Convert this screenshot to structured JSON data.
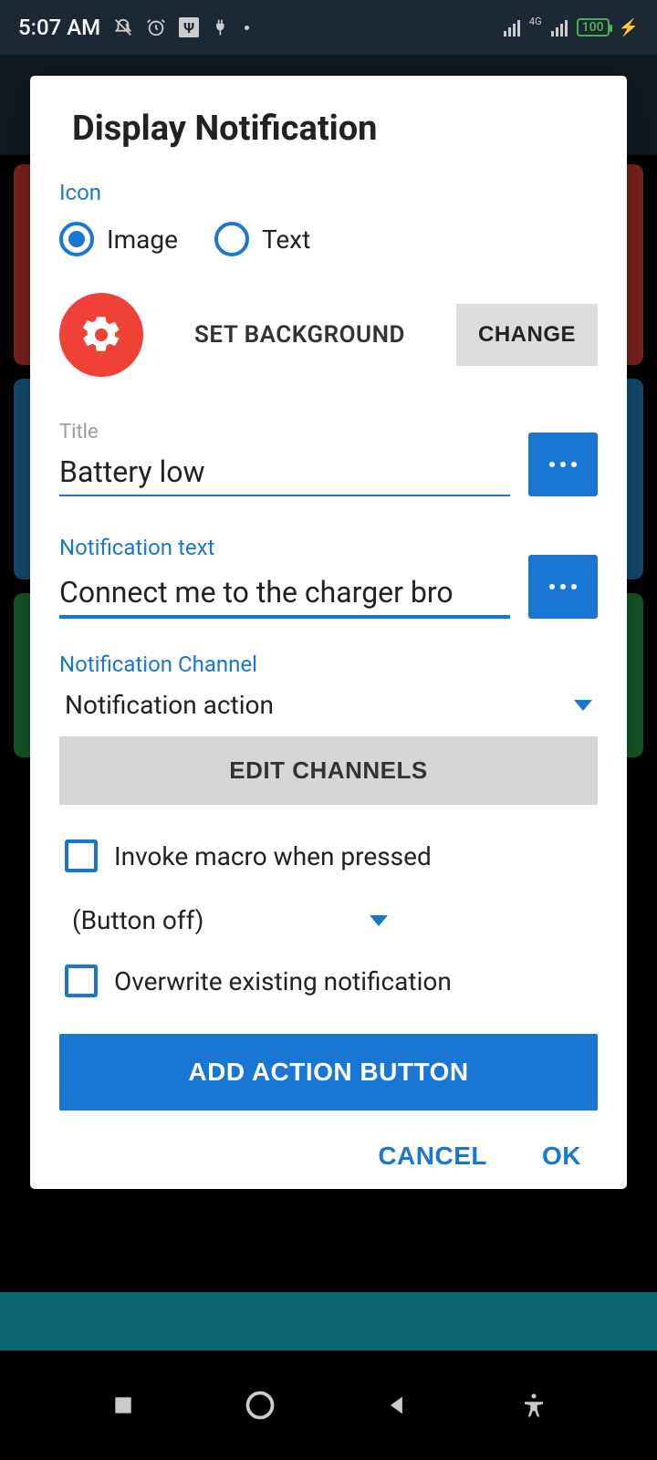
{
  "status": {
    "time": "5:07 AM",
    "battery": "100",
    "network_label": "4G"
  },
  "dialog": {
    "title": "Display Notification",
    "icon_section": "Icon",
    "radio_image": "Image",
    "radio_text": "Text",
    "set_background": "SET BACKGROUND",
    "change": "CHANGE",
    "title_label": "Title",
    "title_value": "Battery low",
    "notif_text_label": "Notification text",
    "notif_text_value": "Connect me to the charger bro",
    "channel_label": "Notification Channel",
    "channel_value": "Notification action",
    "edit_channels": "EDIT CHANNELS",
    "invoke_label": "Invoke macro when pressed",
    "spinner_value": "(Button off)",
    "overwrite_label": "Overwrite existing notification",
    "add_action": "ADD ACTION BUTTON",
    "cancel": "CANCEL",
    "ok": "OK"
  }
}
